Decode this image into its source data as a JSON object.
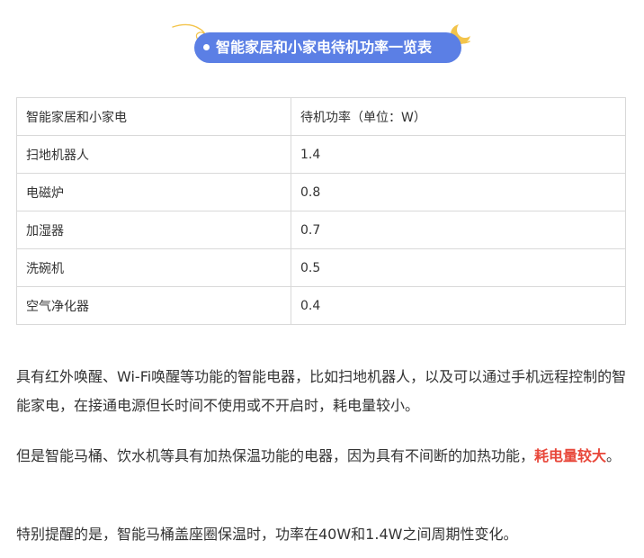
{
  "title": "智能家居和小家电待机功率一览表",
  "table": {
    "headers": [
      "智能家居和小家电",
      "待机功率（单位：W）"
    ],
    "rows": [
      [
        "扫地机器人",
        "1.4"
      ],
      [
        "电磁炉",
        "0.8"
      ],
      [
        "加湿器",
        "0.7"
      ],
      [
        "洗碗机",
        "0.5"
      ],
      [
        "空气净化器",
        "0.4"
      ]
    ]
  },
  "paragraphs": {
    "p1": "具有红外唤醒、Wi-Fi唤醒等功能的智能电器，比如扫地机器人，以及可以通过手机远程控制的智能家电，在接通电源但长时间不使用或不开启时，耗电量较小。",
    "p2_text": "但是智能马桶、饮水机等具有加热保温功能的电器，因为具有不间断的加热功能，",
    "p2_highlight": "耗电量较大",
    "p2_end": "。",
    "p3": "特别提醒的是，智能马桶盖座圈保温时，功率在40W和1.4W之间周期性变化。"
  },
  "colors": {
    "title_pill": "#5b7fe5",
    "highlight": "#e8473a",
    "border": "#d9d9d9",
    "text": "#333333",
    "moon": "#f3c44b"
  },
  "icons": {
    "left_decoration": "cloud-swirl-icon",
    "right_decoration": "moon-icon"
  }
}
